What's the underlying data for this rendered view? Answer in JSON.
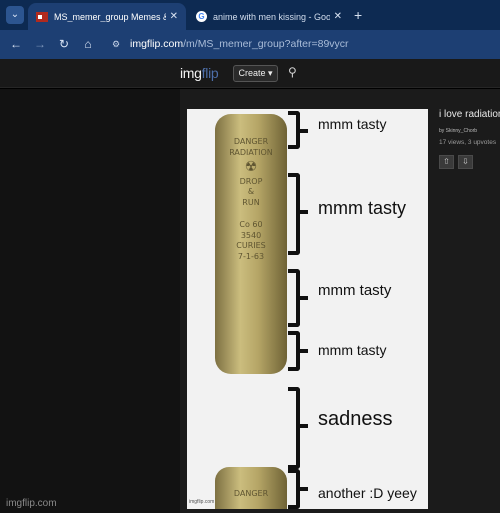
{
  "browser": {
    "tabs": [
      {
        "title": "MS_memer_group Memes & GIFs",
        "active": true,
        "icon": "imgflip-favicon"
      },
      {
        "title": "anime with men kissing - Google Search",
        "active": false,
        "icon": "google-favicon"
      }
    ],
    "close_glyph": "✕",
    "new_tab_glyph": "+",
    "tab_search_glyph": "⌄",
    "nav": {
      "back": "←",
      "forward": "→",
      "reload": "↻",
      "home": "⌂",
      "site_info": "⚙"
    },
    "url": {
      "host": "imgflip.com",
      "path": "/m/MS_memer_group?after=89vycr"
    }
  },
  "site": {
    "logo_img": "img",
    "logo_flip": "flip",
    "create_label": "Create ▾",
    "search_glyph": "⚲",
    "footer": "imgflip.com"
  },
  "meme": {
    "labels": [
      "mmm tasty",
      "mmm tasty",
      "mmm tasty",
      "mmm tasty",
      "sadness",
      "another :D yeey"
    ],
    "canister_text": [
      "DANGER",
      "RADIATION",
      "☢",
      "DROP",
      "&",
      "RUN",
      "Co 60",
      "3540",
      "CURIES",
      "7-1-63"
    ],
    "canister_text_2": "DANGER",
    "watermark": "imgflip.com"
  },
  "post": {
    "title": "i love radiation",
    "by_prefix": "by",
    "author": "Skinny_Chorb",
    "stats": "17 views, 3 upvotes",
    "upvote_glyph": "⇧",
    "downvote_glyph": "⇩"
  },
  "colors": {
    "chrome_dark": "#0d2a52",
    "chrome": "#1d3f73",
    "site_header": "#191919",
    "logo_accent": "#4d6ea8",
    "canister": "#b5a566"
  }
}
